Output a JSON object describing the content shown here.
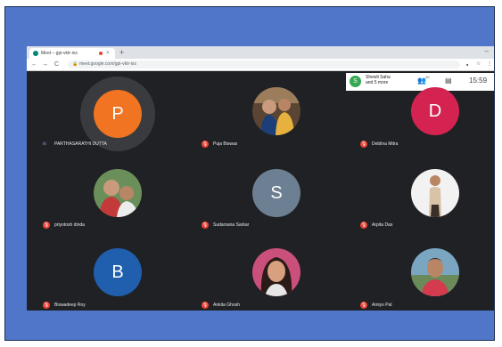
{
  "browser": {
    "tab_title": "Meet – gpi-vktr-ixs",
    "tab_close": "×",
    "new_tab": "+",
    "window_minimize": "–",
    "back": "←",
    "forward": "→",
    "reload": "C",
    "url": "meet.google.com/gpi-vktr-ixs",
    "lock_glyph": "🔒",
    "ext_glyph": "■",
    "star_glyph": "☆",
    "menu_glyph": "⋮"
  },
  "meet_bar": {
    "presenter_initial": "S",
    "people_line1": "Shewli Saha",
    "people_line2": "and 5 more",
    "participants_glyph": "👥",
    "participants_count": "10",
    "chat_glyph": "▤",
    "clock": "15:59"
  },
  "participants": [
    {
      "name": "PARTHASARATHI DUTTA",
      "initial": "P",
      "color": "#f07421",
      "kind": "letter",
      "speaking": true
    },
    {
      "name": "Puja Biswas",
      "kind": "photo",
      "muted": true
    },
    {
      "name": "Deblina Mitra",
      "initial": "D",
      "color": "#d42351",
      "kind": "letter",
      "muted": true
    },
    {
      "name": "priyotosh dinda",
      "kind": "photo",
      "muted": true
    },
    {
      "name": "Sudarsana Sarkar",
      "initial": "S",
      "color": "#6c7f93",
      "kind": "letter",
      "muted": true
    },
    {
      "name": "Arpita Das",
      "kind": "photo",
      "muted": true
    },
    {
      "name": "Biswadeep Roy",
      "initial": "B",
      "color": "#1f5fae",
      "kind": "letter",
      "muted": true
    },
    {
      "name": "Ankita Ghosh",
      "kind": "photo",
      "muted": true
    },
    {
      "name": "Amiyo Pal",
      "kind": "photo",
      "muted": true
    }
  ],
  "mute_glyph": "🎙",
  "speaking_glyph": "ılı",
  "colors": {
    "slide_bg": "#4f76c9",
    "meet_bg": "#202124",
    "mute_red": "#ea4335"
  }
}
